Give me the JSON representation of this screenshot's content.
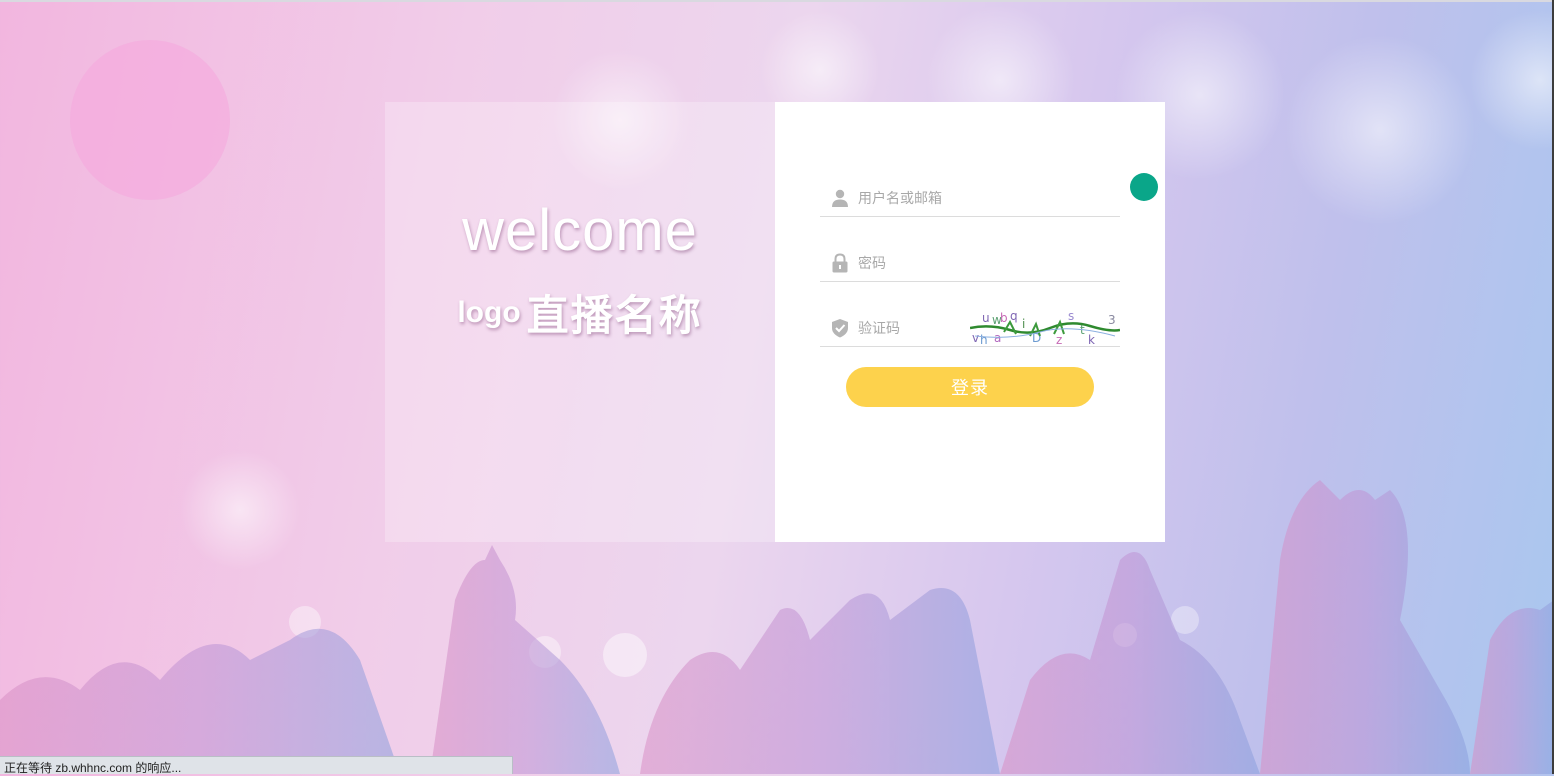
{
  "welcome_panel": {
    "heading": "welcome",
    "logo_text": "logo",
    "site_name": "直播名称"
  },
  "login_form": {
    "username_placeholder": "用户名或邮箱",
    "password_placeholder": "密码",
    "captcha_placeholder": "验证码",
    "submit_label": "登录"
  },
  "captcha_image": {
    "characters": [
      "u",
      "w",
      "b",
      "q",
      "i",
      "s",
      "v",
      "h",
      "a",
      "t",
      "D",
      "z",
      "k",
      "3"
    ]
  },
  "browser_status": {
    "text": "正在等待 zb.whhnc.com 的响应..."
  },
  "colors": {
    "button": "#fdd24c",
    "accent_dot": "#0aa689",
    "card_right": "#ffffff",
    "icon": "#b5b5b5"
  },
  "icons": [
    "user-icon",
    "lock-icon",
    "shield-check-icon"
  ]
}
